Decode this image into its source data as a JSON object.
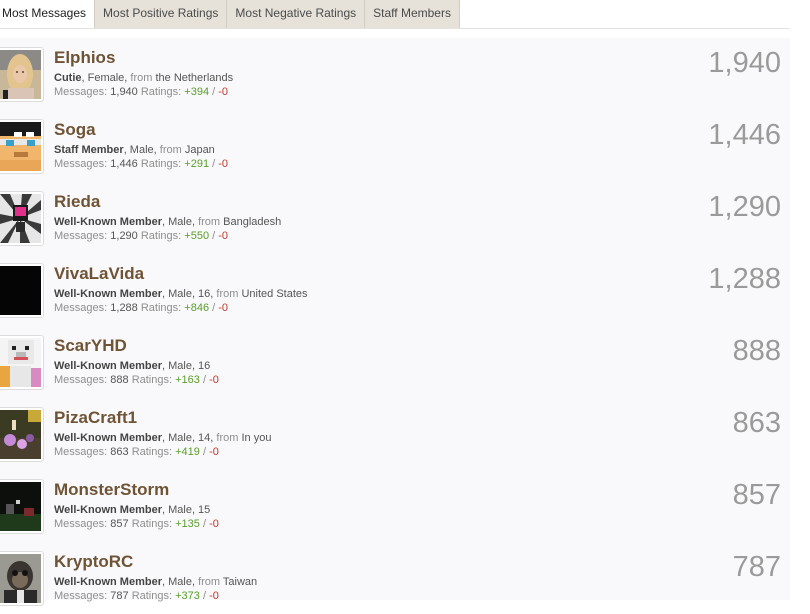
{
  "tabs": [
    {
      "label": "Most Messages",
      "active": true
    },
    {
      "label": "Most Positive Ratings",
      "active": false
    },
    {
      "label": "Most Negative Ratings",
      "active": false
    },
    {
      "label": "Staff Members",
      "active": false
    }
  ],
  "labels": {
    "from": "from",
    "messages": "Messages:",
    "ratings": "Ratings:",
    "slash": "/"
  },
  "colors": {
    "username": "#6e5435",
    "positive": "#5a9e2a",
    "negative": "#c0392b",
    "score": "#9a9a9a"
  },
  "members": [
    {
      "username": "Elphios",
      "title": "Cutie",
      "details": ", Female, ",
      "from": "from",
      "location": "the Netherlands",
      "messages_label": "Messages:",
      "messages": "1,940",
      "ratings_label": "Ratings:",
      "pos": "+394",
      "slash": " / ",
      "neg": "-0",
      "score": "1,940",
      "avatar": "woman-photo-avatar"
    },
    {
      "username": "Soga",
      "title": "Staff Member",
      "details": ", Male, ",
      "from": "from",
      "location": "Japan",
      "messages_label": "Messages:",
      "messages": "1,446",
      "ratings_label": "Ratings:",
      "pos": "+291",
      "slash": " / ",
      "neg": "-0",
      "score": "1,446",
      "avatar": "minecraft-skin-avatar"
    },
    {
      "username": "Rieda",
      "title": "Well-Known Member",
      "details": ", Male, ",
      "from": "from",
      "location": "Bangladesh",
      "messages_label": "Messages:",
      "messages": "1,290",
      "ratings_label": "Ratings:",
      "pos": "+550",
      "slash": " / ",
      "neg": "-0",
      "score": "1,290",
      "avatar": "sunburst-character-avatar"
    },
    {
      "username": "VivaLaVida",
      "title": "Well-Known Member",
      "details": ", Male, 16, ",
      "from": "from",
      "location": "United States",
      "messages_label": "Messages:",
      "messages": "1,288",
      "ratings_label": "Ratings:",
      "pos": "+846",
      "slash": " / ",
      "neg": "-0",
      "score": "1,288",
      "avatar": "black-avatar"
    },
    {
      "username": "ScarYHD",
      "title": "Well-Known Member",
      "details": ", Male, 16",
      "from": "",
      "location": "",
      "messages_label": "Messages:",
      "messages": "888",
      "ratings_label": "Ratings:",
      "pos": "+163",
      "slash": " / ",
      "neg": "-0",
      "score": "888",
      "avatar": "white-bear-skin-avatar"
    },
    {
      "username": "PizaCraft1",
      "title": "Well-Known Member",
      "details": ", Male, 14, ",
      "from": "from",
      "location": "In you",
      "messages_label": "Messages:",
      "messages": "863",
      "ratings_label": "Ratings:",
      "pos": "+419",
      "slash": " / ",
      "neg": "-0",
      "score": "863",
      "avatar": "game-scene-avatar"
    },
    {
      "username": "MonsterStorm",
      "title": "Well-Known Member",
      "details": ", Male, 15",
      "from": "",
      "location": "",
      "messages_label": "Messages:",
      "messages": "857",
      "ratings_label": "Ratings:",
      "pos": "+135",
      "slash": " / ",
      "neg": "-0",
      "score": "857",
      "avatar": "dark-game-scene-avatar"
    },
    {
      "username": "KryptoRC",
      "title": "Well-Known Member",
      "details": ", Male, ",
      "from": "from",
      "location": "Taiwan",
      "messages_label": "Messages:",
      "messages": "787",
      "ratings_label": "Ratings:",
      "pos": "+373",
      "slash": " / ",
      "neg": "-0",
      "score": "787",
      "avatar": "monkey-photo-avatar"
    }
  ]
}
